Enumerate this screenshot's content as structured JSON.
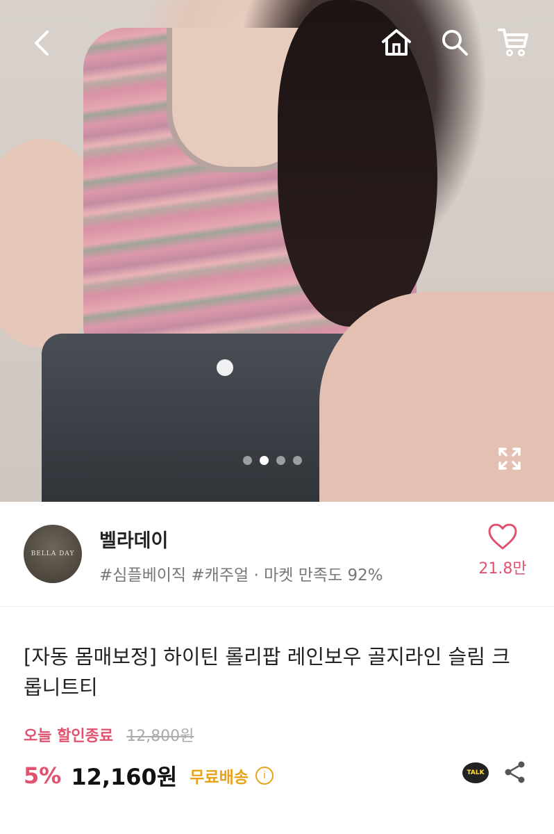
{
  "hero": {
    "image_alt": "Model wearing pink rainbow striped rib knit crop t-shirt with dark denim",
    "carousel": {
      "total": 4,
      "active_index": 1
    }
  },
  "topbar": {
    "icons": [
      "back-icon",
      "home-icon",
      "search-icon",
      "cart-icon"
    ]
  },
  "seller": {
    "avatar_text": "BELLA DAY",
    "name": "벨라데이",
    "tags": "#심플베이직 #캐주얼 · 마켓 만족도 92%",
    "like_count": "21.8만"
  },
  "product": {
    "title": "[자동 몸매보정] 하이틴 롤리팝 레인보우 골지라인 슬림 크롭니트티",
    "promo_label": "오늘 할인종료",
    "original_price": "12,800원",
    "discount": "5%",
    "price": "12,160원",
    "shipping": "무료배송",
    "talk_label": "TALK"
  },
  "colors": {
    "accent": "#e0526f",
    "shipping": "#e8a31d"
  }
}
